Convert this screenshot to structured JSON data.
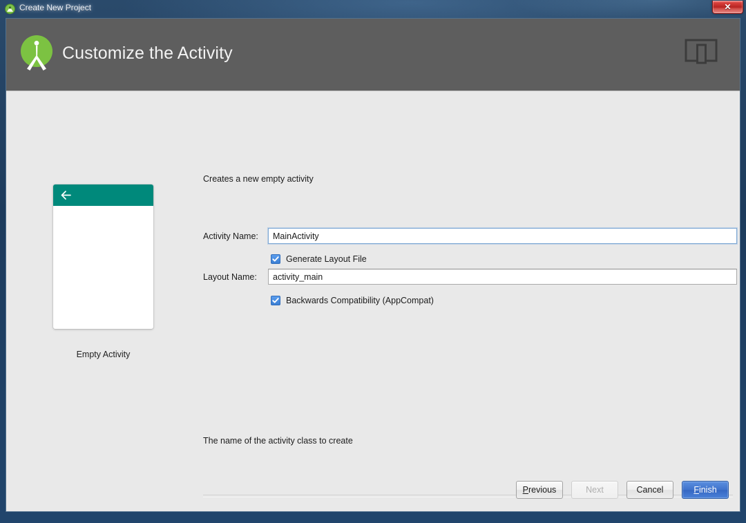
{
  "window": {
    "title": "Create New Project",
    "title_icon": "android-icon",
    "close_label": "✕"
  },
  "header": {
    "logo_icon": "android-studio-logo-icon",
    "title": "Customize the Activity",
    "device_icon": "device-layout-icon"
  },
  "preview": {
    "back_icon": "back-arrow-icon",
    "label": "Empty Activity",
    "appbar_color": "#00897b"
  },
  "form": {
    "description": "Creates a new empty activity",
    "fields": [
      {
        "label": "Activity Name:",
        "value": "MainActivity",
        "placeholder": "Activity Name",
        "focused": true
      },
      {
        "label": "Layout Name:",
        "value": "activity_main",
        "placeholder": "Layout Name",
        "focused": false
      }
    ],
    "checkboxes": [
      {
        "label": "Generate Layout File",
        "checked": true
      },
      {
        "label": "Backwards Compatibility (AppCompat)",
        "checked": true
      }
    ],
    "hint": "The name of the activity class to create"
  },
  "buttons": {
    "previous": {
      "label": "Previous",
      "accel": "P",
      "enabled": true
    },
    "next": {
      "label": "Next",
      "enabled": false
    },
    "cancel": {
      "label": "Cancel",
      "enabled": true
    },
    "finish": {
      "label": "Finish",
      "accel": "F",
      "enabled": true,
      "primary": true
    }
  },
  "colors": {
    "accent_blue": "#3f72cb",
    "teal": "#00897b",
    "header_gray": "#5e5e5e",
    "panel_gray": "#e9e9e9",
    "checkbox_blue": "#3b7fd4"
  }
}
